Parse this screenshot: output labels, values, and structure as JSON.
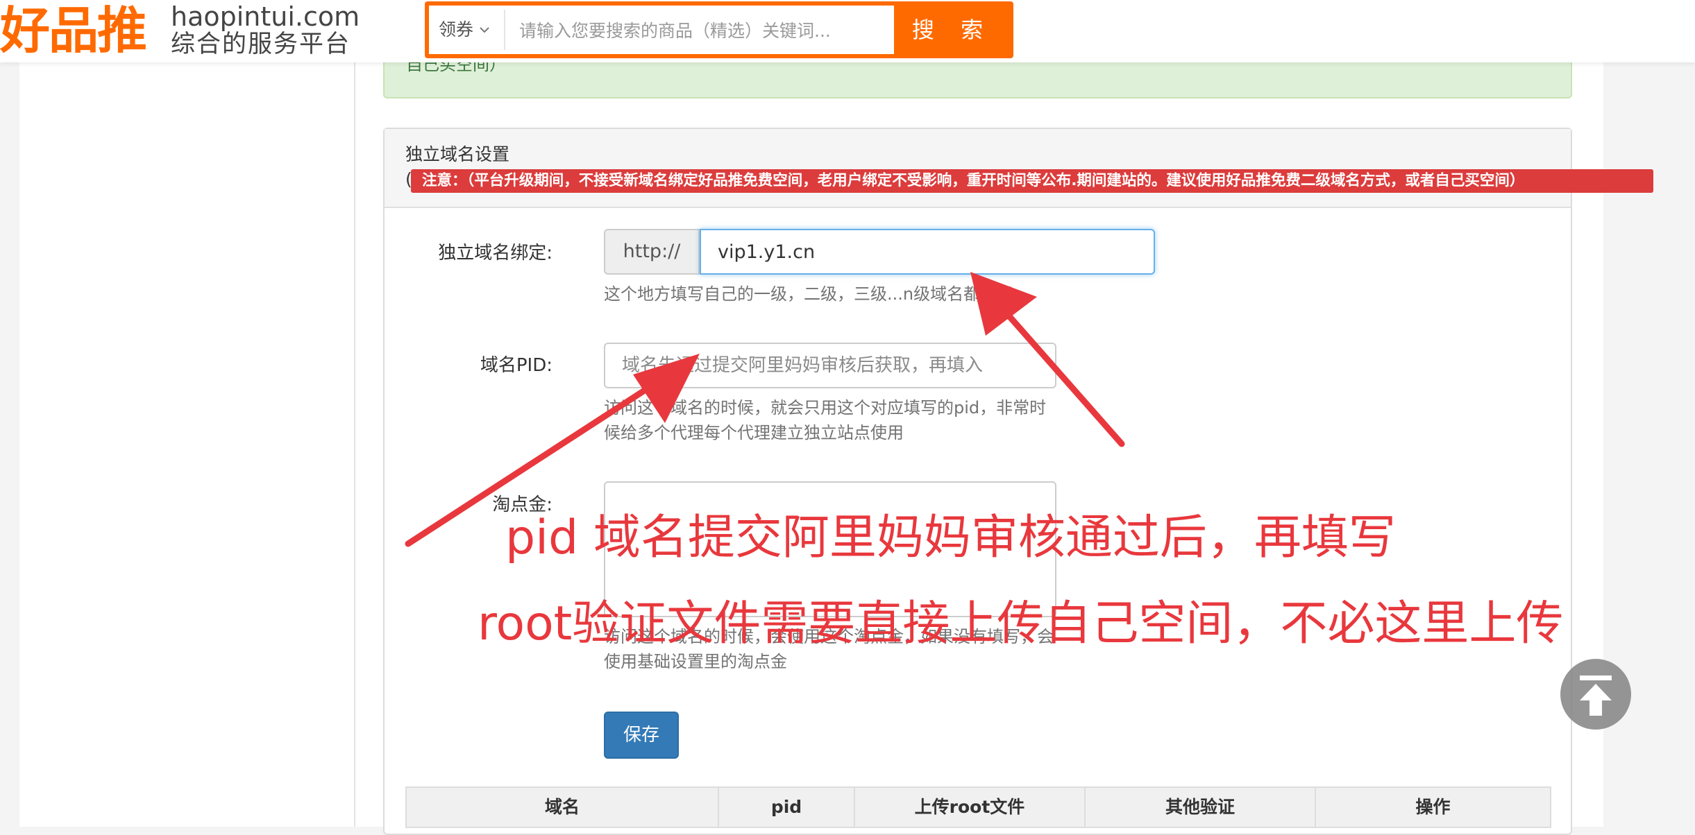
{
  "header": {
    "logo_cn": "好品推",
    "logo_domain": "haopintui.com",
    "logo_tagline": "综合的服务平台",
    "search": {
      "filter_label": "领券",
      "placeholder": "请输入您要搜索的商品（精选）关键词...",
      "button_label": "搜 索"
    }
  },
  "notice": {
    "text": "注意：（平台升级期间，不接受新域名绑定好品推免费空间，老用户绑定不受影响，重开时间等公布.期间建站的。建议使用好品推免费二级域名方式，或者自己买空间）"
  },
  "panel": {
    "title": "独立域名设置",
    "paren": "(",
    "warning": "注意：（平台升级期间，不接受新域名绑定好品推免费空间，老用户绑定不受影响，重开时间等公布.期间建站的。建议使用好品推免费二级域名方式，或者自己买空间）"
  },
  "form": {
    "domain": {
      "label": "独立域名绑定:",
      "prefix": "http://",
      "value": "vip1.y1.cn",
      "help": "这个地方填写自己的一级，二级，三级...n级域名都可以"
    },
    "pid": {
      "label": "域名PID:",
      "placeholder": "域名先通过提交阿里妈妈审核后获取，再填入",
      "help": "访问这个域名的时候，就会只用这个对应填写的pid，非常时候给多个代理每个代理建立独立站点使用"
    },
    "taodianjin": {
      "label": "淘点金:",
      "value": "",
      "help": "访问这个域名的时候，会使用这个淘点金，如果没有填写，会使用基础设置里的淘点金"
    },
    "save_label": "保存"
  },
  "table": {
    "columns": [
      "域名",
      "pid",
      "上传root文件",
      "其他验证",
      "操作"
    ]
  },
  "annotations": {
    "line1": "pid 域名提交阿里妈妈审核通过后，再填写",
    "line2": "root验证文件需要直接上传自己空间，不必这里上传"
  },
  "colors": {
    "brand_orange": "#ff6a00",
    "annotation_red": "#e8383d",
    "warning_red": "#dc3c3c",
    "primary_blue": "#337ab7",
    "success_bg": "#dff0d8"
  },
  "icons": {
    "chevron": "chevron-down-icon",
    "back_to_top": "arrow-up-icon"
  }
}
